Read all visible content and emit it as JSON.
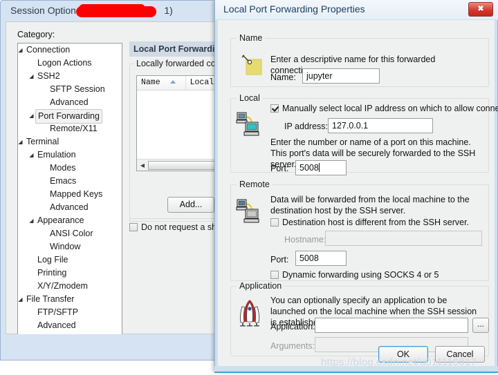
{
  "session_window": {
    "title_prefix": "Session Options - ",
    "title_suffix": "1)",
    "category_label": "Category:",
    "tree": [
      {
        "label": "Connection",
        "indent": 0,
        "arrow": true,
        "selected": false
      },
      {
        "label": "Logon Actions",
        "indent": 1,
        "arrow": false,
        "selected": false
      },
      {
        "label": "SSH2",
        "indent": 1,
        "arrow": true,
        "selected": false
      },
      {
        "label": "SFTP Session",
        "indent": 2,
        "arrow": false,
        "selected": false
      },
      {
        "label": "Advanced",
        "indent": 2,
        "arrow": false,
        "selected": false
      },
      {
        "label": "Port Forwarding",
        "indent": 1,
        "arrow": true,
        "selected": true
      },
      {
        "label": "Remote/X11",
        "indent": 2,
        "arrow": false,
        "selected": false
      },
      {
        "label": "Terminal",
        "indent": 0,
        "arrow": true,
        "selected": false
      },
      {
        "label": "Emulation",
        "indent": 1,
        "arrow": true,
        "selected": false
      },
      {
        "label": "Modes",
        "indent": 2,
        "arrow": false,
        "selected": false
      },
      {
        "label": "Emacs",
        "indent": 2,
        "arrow": false,
        "selected": false
      },
      {
        "label": "Mapped Keys",
        "indent": 2,
        "arrow": false,
        "selected": false
      },
      {
        "label": "Advanced",
        "indent": 2,
        "arrow": false,
        "selected": false
      },
      {
        "label": "Appearance",
        "indent": 1,
        "arrow": true,
        "selected": false
      },
      {
        "label": "ANSI Color",
        "indent": 2,
        "arrow": false,
        "selected": false
      },
      {
        "label": "Window",
        "indent": 2,
        "arrow": false,
        "selected": false
      },
      {
        "label": "Log File",
        "indent": 1,
        "arrow": false,
        "selected": false
      },
      {
        "label": "Printing",
        "indent": 1,
        "arrow": false,
        "selected": false
      },
      {
        "label": "X/Y/Zmodem",
        "indent": 1,
        "arrow": false,
        "selected": false
      },
      {
        "label": "File Transfer",
        "indent": 0,
        "arrow": true,
        "selected": false
      },
      {
        "label": "FTP/SFTP",
        "indent": 1,
        "arrow": false,
        "selected": false
      },
      {
        "label": "Advanced",
        "indent": 1,
        "arrow": false,
        "selected": false
      }
    ],
    "panel_heading": "Local Port Forwarding",
    "group_title": "Locally forwarded connect",
    "list_columns": [
      "Name",
      "Local Add"
    ],
    "list_rows": [],
    "add_button": "Add...",
    "do_not_request_shell": "Do not request a shell",
    "do_not_request_shell_checked": false
  },
  "dialog": {
    "title": "Local Port Forwarding Properties",
    "close_icon": "✖",
    "name_group": {
      "title": "Name",
      "description": "Enter a descriptive name for this forwarded connection.",
      "field_label": "Name:",
      "value": "jupyter"
    },
    "local_group": {
      "title": "Local",
      "checkbox_label": "Manually select local IP address on which to allow connections.",
      "checkbox_checked": true,
      "ip_label": "IP address:",
      "ip_value": "127.0.0.1",
      "description": "Enter the number or name of a port on this machine.  This port's data will be securely forwarded to the SSH server.",
      "port_label": "Port:",
      "port_value": "5008"
    },
    "remote_group": {
      "title": "Remote",
      "description": "Data will be forwarded from the local machine to the destination host by the SSH server.",
      "checkbox_label": "Destination host is different from the SSH server.",
      "checkbox_checked": false,
      "hostname_label": "Hostname:",
      "hostname_value": "",
      "port_label": "Port:",
      "port_value": "5008",
      "socks_label": "Dynamic forwarding using SOCKS 4 or 5",
      "socks_checked": false
    },
    "application_group": {
      "title": "Application",
      "description": "You can optionally specify an application to be launched on the local machine when the SSH session is established.",
      "application_label": "Application:",
      "application_value": "",
      "browse_button": "...",
      "arguments_label": "Arguments:",
      "arguments_value": ""
    },
    "ok_button": "OK",
    "cancel_button": "Cancel"
  },
  "watermark": "https://blog.csdn.net/u011119817",
  "colors": {
    "accent": "#3c9ad6",
    "titlebar": "#d6e3f2",
    "dialog_bg": "#eff0f0",
    "redaction": "#fe0000",
    "close_red": "#d6392f"
  }
}
